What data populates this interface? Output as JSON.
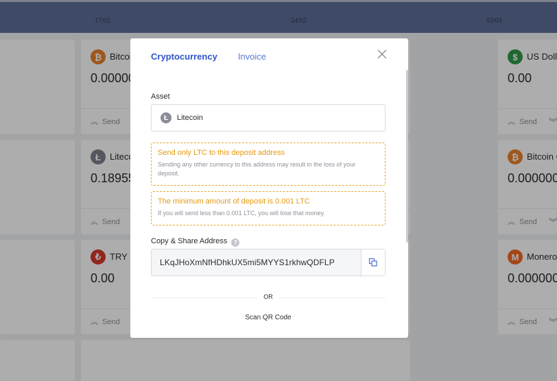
{
  "chart": {
    "dates": [
      "17/02",
      "24/02",
      "03/03"
    ]
  },
  "cards": [
    {
      "name": "Bitcoin",
      "balance": "0.00000",
      "icon": "bitcoin-icon",
      "glyph": "₿",
      "color": "#e8812a",
      "send": "Send"
    },
    {
      "name": "Litecoin",
      "balance": "0.18955",
      "icon": "litecoin-icon",
      "glyph": "Ł",
      "color": "#7d828b",
      "send": "Send"
    },
    {
      "name": "TRY",
      "balance": "0.00",
      "icon": "lira-icon",
      "glyph": "₺",
      "color": "#d5382c",
      "send": "Send"
    },
    {
      "name": "US Dollar",
      "balance": "0.00",
      "icon": "dollar-icon",
      "glyph": "$",
      "color": "#2f9a4a",
      "send": "Send"
    },
    {
      "name": "Bitcoin Cash",
      "balance": "0.000000",
      "icon": "bitcoin-cash-icon",
      "glyph": "₿",
      "color": "#e8812a",
      "send": "Send"
    },
    {
      "name": "Monero",
      "balance": "0.000000",
      "icon": "monero-icon",
      "glyph": "M",
      "color": "#f26822",
      "send": "Send"
    }
  ],
  "modal": {
    "tabs": [
      "Cryptocurrency",
      "Invoice"
    ],
    "active_tab": "Cryptocurrency",
    "asset_label": "Asset",
    "asset_value": "Litecoin",
    "warning1_title": "Send only LTC to this deposit address",
    "warning1_text": "Sending any other currency to this address may result in the loss of your deposit.",
    "warning2_title": "The minimum amount of deposit is 0.001 LTC",
    "warning2_text": "If you will send less than 0.001 LTC, you will lose that money.",
    "address_label": "Copy & Share Address",
    "address": "LKqJHoXmNfHDhkUX5mi5MYYS1rkhwQDFLP",
    "or_text": "OR",
    "qr_text": "Scan QR Code"
  },
  "colors": {
    "accent": "#2f55c7",
    "warning": "#e39a12",
    "chart_band": "#5d6d97"
  }
}
